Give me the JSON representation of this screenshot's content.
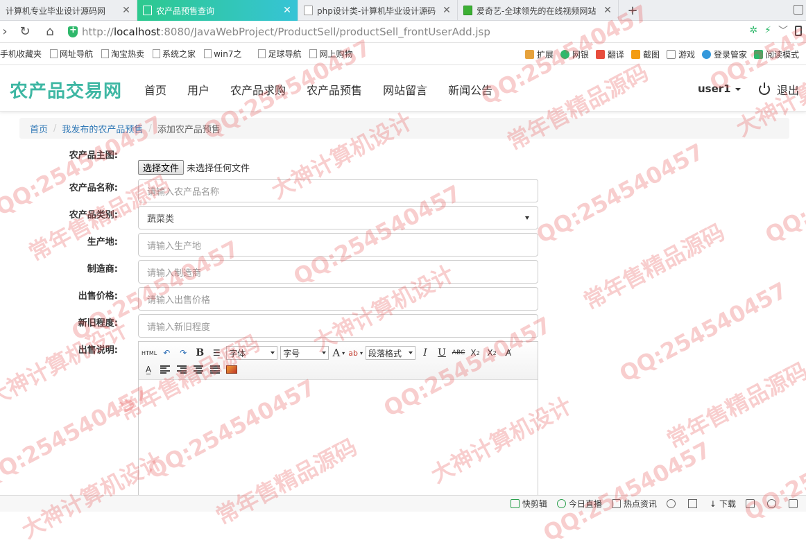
{
  "browser": {
    "tabs": [
      {
        "label": "计算机专业毕业设计源码网",
        "active": false
      },
      {
        "label": "农产品预售查询",
        "active": true
      },
      {
        "label": "php设计类-计算机毕业设计源码",
        "active": false
      },
      {
        "label": "爱奇艺-全球领先的在线视频网站",
        "active": false
      }
    ],
    "url_prefix": "http://",
    "url_host": "localhost",
    "url_path": ":8080/JavaWebProject/ProductSell/productSell_frontUserAdd.jsp"
  },
  "bookmarks": {
    "left": [
      "手机收藏夹",
      "网址导航",
      "淘宝热卖",
      "系统之家",
      "win7之",
      "足球导航",
      "网上购物"
    ],
    "right": [
      "扩展",
      "网银",
      "翻译",
      "截图",
      "游戏",
      "登录管家",
      "阅读模式"
    ]
  },
  "site": {
    "brand": "农产品交易网",
    "menu": [
      "首页",
      "用户",
      "农产品求购",
      "农产品预售",
      "网站留言",
      "新闻公告"
    ],
    "user": "user1",
    "logout": "退出"
  },
  "breadcrumb": {
    "home": "首页",
    "list": "我发布的农产品预售",
    "current": "添加农产品预售"
  },
  "form": {
    "image_label": "农产品主图:",
    "file_button": "选择文件",
    "file_status": "未选择任何文件",
    "name_label": "农产品名称:",
    "name_placeholder": "请输入农产品名称",
    "category_label": "农产品类别:",
    "category_value": "蔬菜类",
    "origin_label": "生产地:",
    "origin_placeholder": "请输入生产地",
    "maker_label": "制造商:",
    "maker_placeholder": "请输入制造商",
    "price_label": "出售价格:",
    "price_placeholder": "请输入出售价格",
    "condition_label": "新旧程度:",
    "condition_placeholder": "请输入新旧程度",
    "desc_label": "出售说明:"
  },
  "editor": {
    "html_btn": "HTML",
    "font_family": "字体",
    "font_size": "字号",
    "paragraph": "段落格式",
    "bold": "B",
    "italic": "I",
    "underline": "U",
    "strike": "ABC"
  },
  "statusbar": [
    "快剪辑",
    "今日直播",
    "热点资讯",
    "下载"
  ],
  "watermarks": [
    "常年售精品源码",
    "QQ:254540457",
    "大神计算机设计"
  ]
}
